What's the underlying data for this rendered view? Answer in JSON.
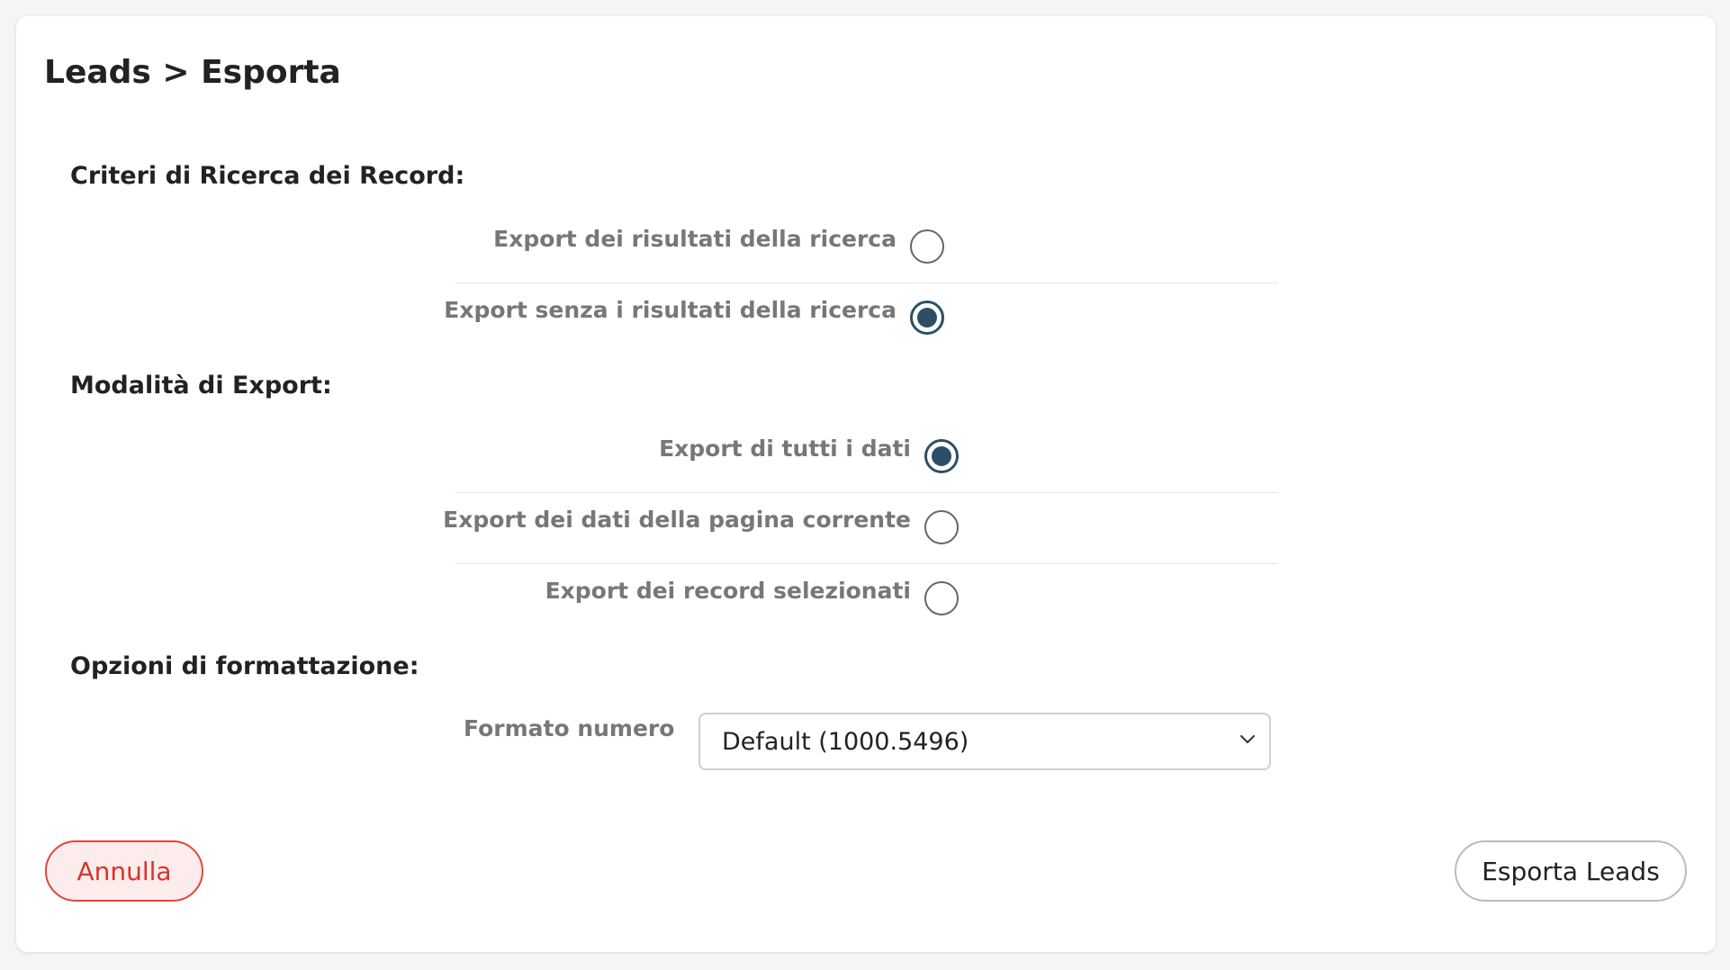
{
  "header": {
    "title": "Leads > Esporta"
  },
  "search_criteria": {
    "title": "Criteri di Ricerca dei Record:",
    "options": [
      {
        "label": "Export dei risultati della ricerca",
        "checked": false
      },
      {
        "label": "Export senza i risultati della ricerca",
        "checked": true
      }
    ]
  },
  "export_mode": {
    "title": "Modalità di Export:",
    "options": [
      {
        "label": "Export di tutti i dati",
        "checked": true
      },
      {
        "label": "Export dei dati della pagina corrente",
        "checked": false
      },
      {
        "label": "Export dei record selezionati",
        "checked": false
      }
    ]
  },
  "formatting": {
    "title": "Opzioni di formattazione:",
    "number_format_label": "Formato numero",
    "number_format_value": "Default (1000.5496)"
  },
  "footer": {
    "cancel_label": "Annulla",
    "export_label": "Esporta Leads"
  },
  "colors": {
    "accent": "#2b4f66",
    "cancel": "#d8332a",
    "label": "#777777"
  },
  "icons": {
    "select_arrow": "chevron-down-icon"
  }
}
